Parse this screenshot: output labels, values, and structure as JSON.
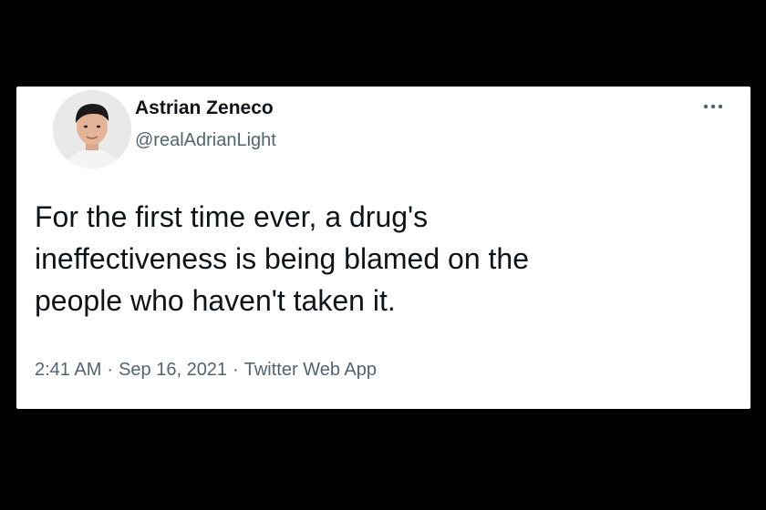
{
  "tweet": {
    "display_name": "Astrian Zeneco",
    "handle": "@realAdrianLight",
    "text": "For the first time ever, a drug's\nineffectiveness is being blamed on the\npeople who haven't taken it.",
    "time": "2:41 AM",
    "date": "Sep 16, 2021",
    "source": "Twitter Web App",
    "separator": "·",
    "more_icon": "more-horizontal-icon",
    "avatar_icon": "user-avatar"
  },
  "colors": {
    "page_background": "#000000",
    "card_background": "#ffffff",
    "primary_text": "#0f1419",
    "secondary_text": "#536471"
  }
}
